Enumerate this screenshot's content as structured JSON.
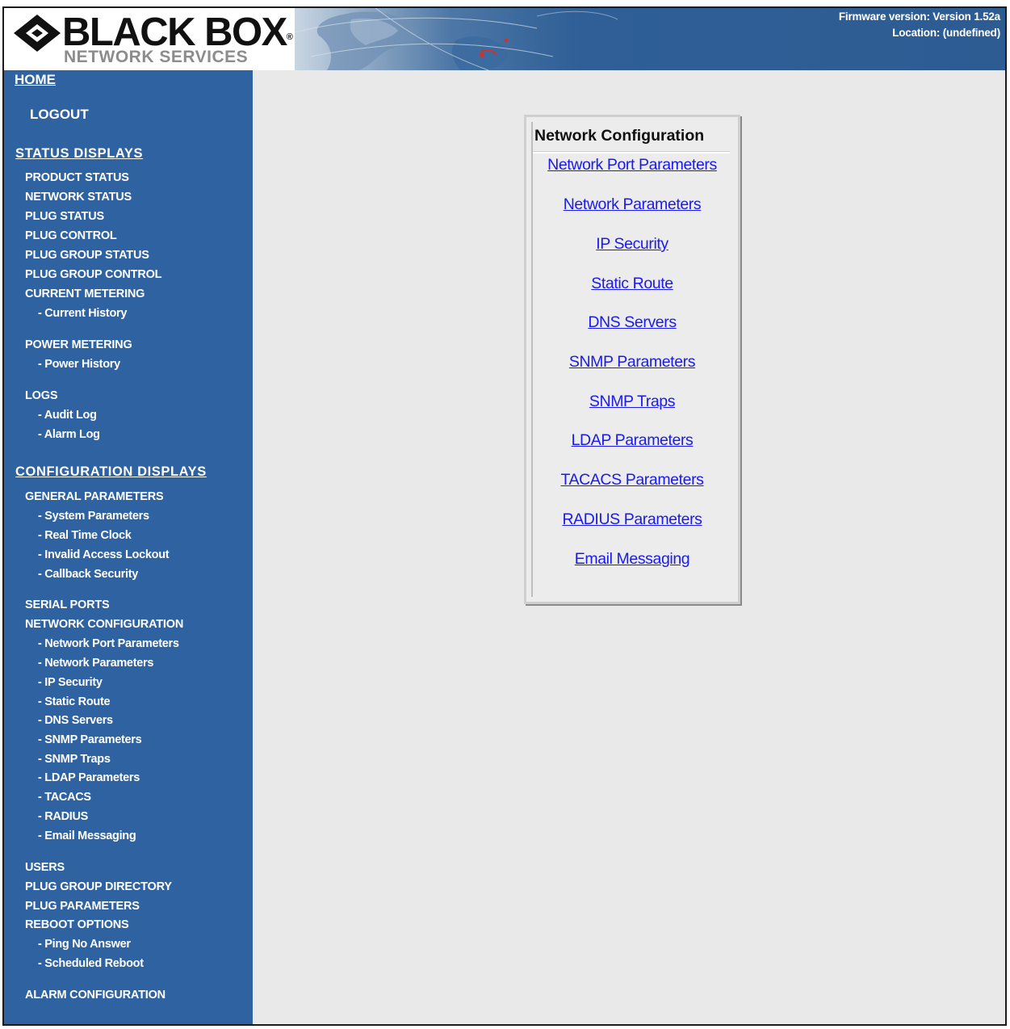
{
  "header": {
    "logo_main": "BLACK BOX",
    "logo_registered": "®",
    "logo_sub": "NETWORK SERVICES",
    "firmware": "Firmware version: Version 1.52a",
    "location": "Location: (undefined)"
  },
  "sidebar": {
    "home": "HOME",
    "logout": "LOGOUT",
    "status_heading": "STATUS DISPLAYS",
    "status_items": {
      "product_status": "PRODUCT STATUS",
      "network_status": "NETWORK STATUS",
      "plug_status": "PLUG STATUS",
      "plug_control": "PLUG CONTROL",
      "plug_group_status": "PLUG GROUP STATUS",
      "plug_group_control": "PLUG GROUP CONTROL",
      "current_metering": "CURRENT METERING",
      "current_history": "- Current History",
      "power_metering": "POWER METERING",
      "power_history": "- Power History",
      "logs": "LOGS",
      "audit_log": "- Audit Log",
      "alarm_log": "- Alarm Log"
    },
    "config_heading": "CONFIGURATION DISPLAYS",
    "config_items": {
      "general_parameters": "GENERAL PARAMETERS",
      "system_parameters": "- System Parameters",
      "real_time_clock": "- Real Time Clock",
      "invalid_access_lockout": "- Invalid Access Lockout",
      "callback_security": "- Callback Security",
      "serial_ports": "SERIAL PORTS",
      "network_configuration": "NETWORK CONFIGURATION",
      "network_port_parameters": "- Network Port Parameters",
      "network_parameters": "- Network Parameters",
      "ip_security": "- IP Security",
      "static_route": "- Static Route",
      "dns_servers": "- DNS Servers",
      "snmp_parameters": "- SNMP Parameters",
      "snmp_traps": "- SNMP Traps",
      "ldap_parameters": "- LDAP Parameters",
      "tacacs": "- TACACS",
      "radius": "- RADIUS",
      "email_messaging": "- Email Messaging",
      "users": "USERS",
      "plug_group_directory": "PLUG GROUP DIRECTORY",
      "plug_parameters": "PLUG PARAMETERS",
      "reboot_options": "REBOOT OPTIONS",
      "ping_no_answer": "- Ping No Answer",
      "scheduled_reboot": "- Scheduled Reboot",
      "alarm_configuration": "ALARM CONFIGURATION"
    }
  },
  "panel": {
    "title": "Network Configuration",
    "links": {
      "network_port_parameters": "Network Port Parameters",
      "network_parameters": "Network Parameters",
      "ip_security": "IP Security",
      "static_route": "Static Route",
      "dns_servers": "DNS Servers",
      "snmp_parameters": "SNMP Parameters",
      "snmp_traps": "SNMP Traps",
      "ldap_parameters": "LDAP Parameters",
      "tacacs_parameters": "TACACS Parameters",
      "radius_parameters": "RADIUS Parameters",
      "email_messaging": "Email Messaging"
    }
  },
  "colors": {
    "sidebar_bg": "#2f62a0",
    "content_bg": "#e9e9e9",
    "link": "#1a1aee"
  },
  "icons": {
    "logo": "black-box-diamond-logo",
    "banner": "world-map-banner"
  }
}
